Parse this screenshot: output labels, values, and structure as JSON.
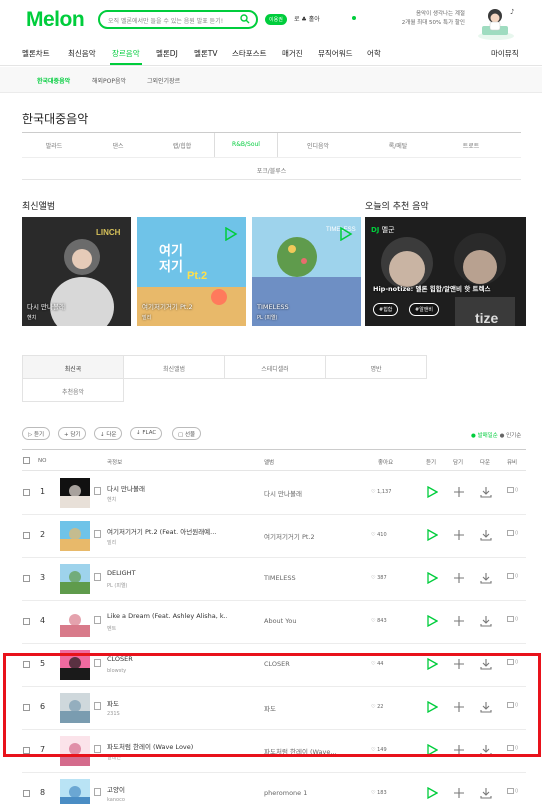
{
  "header": {
    "logo": "Melon",
    "search_placeholder": "오직 멜론에서만 들을 수 있는 음원 발표 듣기!",
    "badge": "이용권",
    "user": "로 ♣ 홀아",
    "promo_line1": "음악이 생각나는 계절",
    "promo_line2": "2개월 최대 50% 특가 할인"
  },
  "gnb": {
    "items": [
      "멜론차트",
      "최신음악",
      "장르음악",
      "멜론DJ",
      "멜론TV",
      "스타포스트",
      "매거진",
      "뮤직어워드",
      "어학"
    ],
    "right": "마이뮤직"
  },
  "sub_gnb": {
    "items": [
      "한국대중음악",
      "해외POP음악",
      "그외인기장르"
    ]
  },
  "page_title": "한국대중음악",
  "genre_tabs": {
    "row1": [
      "발라드",
      "댄스",
      "랩/힙합",
      "R&B/Soul",
      "인디음악",
      "록/메탈",
      "트로트"
    ],
    "row2": [
      "포크/블루스"
    ]
  },
  "latest_albums": {
    "title": "최신앨범",
    "items": [
      {
        "title": "다시 만나볼래",
        "artist": "헨치"
      },
      {
        "title": "여기저기거기 Pt.2",
        "artist": "빌리"
      },
      {
        "title": "TIMELESS",
        "artist": "PL (피엘)"
      }
    ]
  },
  "recommend": {
    "title": "오늘의 추천 음악",
    "dj_prefix": "DJ",
    "dj_name": "멜군",
    "desc": "Hip-notize: 멜론 힙합/알앤비 핫 트렉스",
    "tags": [
      "#힙합",
      "#알앤비"
    ]
  },
  "content_tabs": {
    "row1": [
      "최신곡",
      "최신앨범",
      "스테디셀러",
      "명반"
    ],
    "row2": [
      "추천음악"
    ]
  },
  "toolbar": {
    "buttons": [
      "듣기",
      "담기",
      "다운",
      "FLAC",
      "선물"
    ],
    "sort1": "발매일순",
    "sort2": "인기순"
  },
  "table": {
    "headers": {
      "no": "NO",
      "song": "곡정보",
      "album": "앨범",
      "like": "좋아요",
      "listen": "듣기",
      "add": "담기",
      "download": "다운",
      "mv": "뮤비"
    },
    "rows": [
      {
        "rank": "1",
        "title": "다시 만나볼래",
        "artist": "헨치",
        "album": "다시 만나볼래",
        "likes": "1,137"
      },
      {
        "rank": "2",
        "title": "여기저기거기 Pt.2 (Feat. 아넌원래예...",
        "artist": "빌리",
        "album": "여기저기거기 Pt.2",
        "likes": "410"
      },
      {
        "rank": "3",
        "title": "DELIGHT",
        "artist": "PL (피엘)",
        "album": "TIMELESS",
        "likes": "387"
      },
      {
        "rank": "4",
        "title": "Like a Dream (Feat. Ashley Alisha, k...",
        "artist": "벤트",
        "album": "About You",
        "likes": "843"
      },
      {
        "rank": "5",
        "title": "CLOSER",
        "artist": "blowsty",
        "album": "CLOSER",
        "likes": "44"
      },
      {
        "rank": "6",
        "title": "파도",
        "artist": "231S",
        "album": "파도",
        "likes": "22"
      },
      {
        "rank": "7",
        "title": "파도처럼 한레이 (Wave Love)",
        "artist": "일레인",
        "album": "파도처럼 한레이 (Wave...",
        "likes": "149"
      },
      {
        "rank": "8",
        "title": "고양이",
        "artist": "kanoco",
        "album": "pheromone 1",
        "likes": "183"
      }
    ],
    "mv_label": "0"
  },
  "colors": {
    "accent": "#00cd3c",
    "highlight": "#e8121b"
  }
}
